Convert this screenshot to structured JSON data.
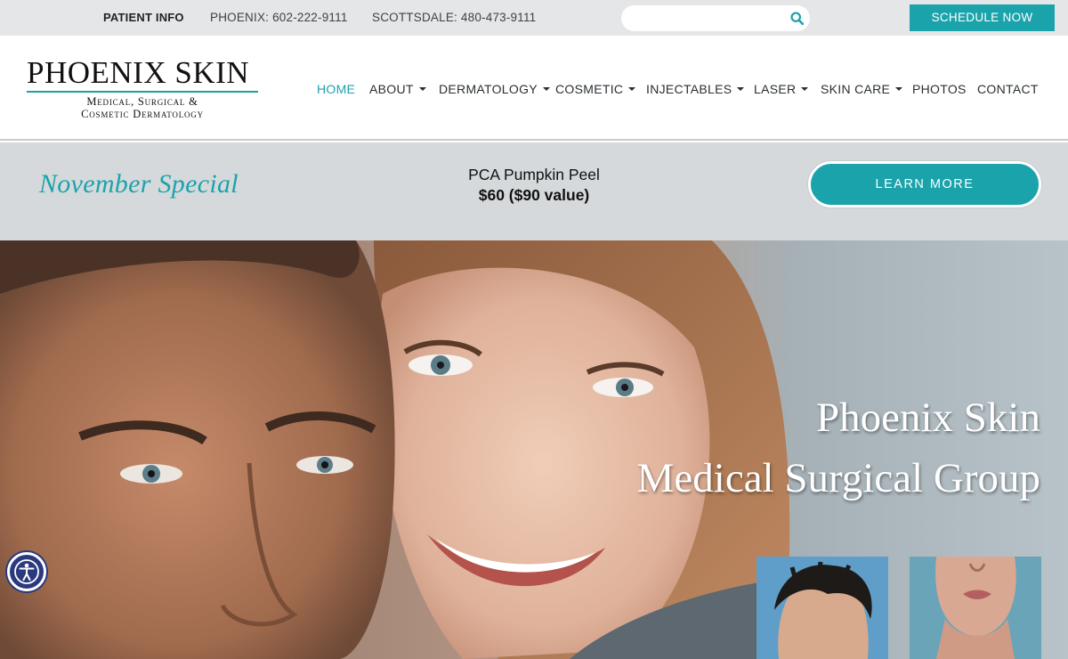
{
  "topbar": {
    "patient_info": "PATIENT INFO",
    "phone_phoenix": "PHOENIX: 602-222-9111",
    "phone_scottsdale": "SCOTTSDALE: 480-473-9111",
    "search_placeholder": "",
    "search_icon": "search-icon",
    "schedule_label": "SCHEDULE NOW"
  },
  "logo": {
    "name": "PHOENIX SKIN",
    "line1": "Medical, Surgical &",
    "line2": "Cosmetic Dermatology"
  },
  "nav": {
    "items": [
      {
        "label": "HOME",
        "dropdown": false,
        "active": true
      },
      {
        "label": "ABOUT",
        "dropdown": true
      },
      {
        "label": "DERMATOLOGY",
        "dropdown": true
      },
      {
        "label": "COSMETIC",
        "dropdown": true
      },
      {
        "label": "INJECTABLES",
        "dropdown": true
      },
      {
        "label": "LASER",
        "dropdown": true
      },
      {
        "label": "SKIN CARE",
        "dropdown": true
      },
      {
        "label": "PHOTOS",
        "dropdown": false
      },
      {
        "label": "CONTACT",
        "dropdown": false
      }
    ]
  },
  "promo": {
    "title": "November Special",
    "offer_name": "PCA Pumpkin Peel",
    "offer_price": "$60 ($90 value)",
    "cta": "LEARN MORE"
  },
  "hero": {
    "line1": "Phoenix Skin",
    "line2": "Medical Surgical Group"
  },
  "colors": {
    "accent": "#1ba3ab",
    "topbar_bg": "#e4e6e8",
    "promo_bg": "#d5d9db",
    "accessibility": "#2b3a7e"
  },
  "accessibility": {
    "icon": "accessibility-icon"
  }
}
